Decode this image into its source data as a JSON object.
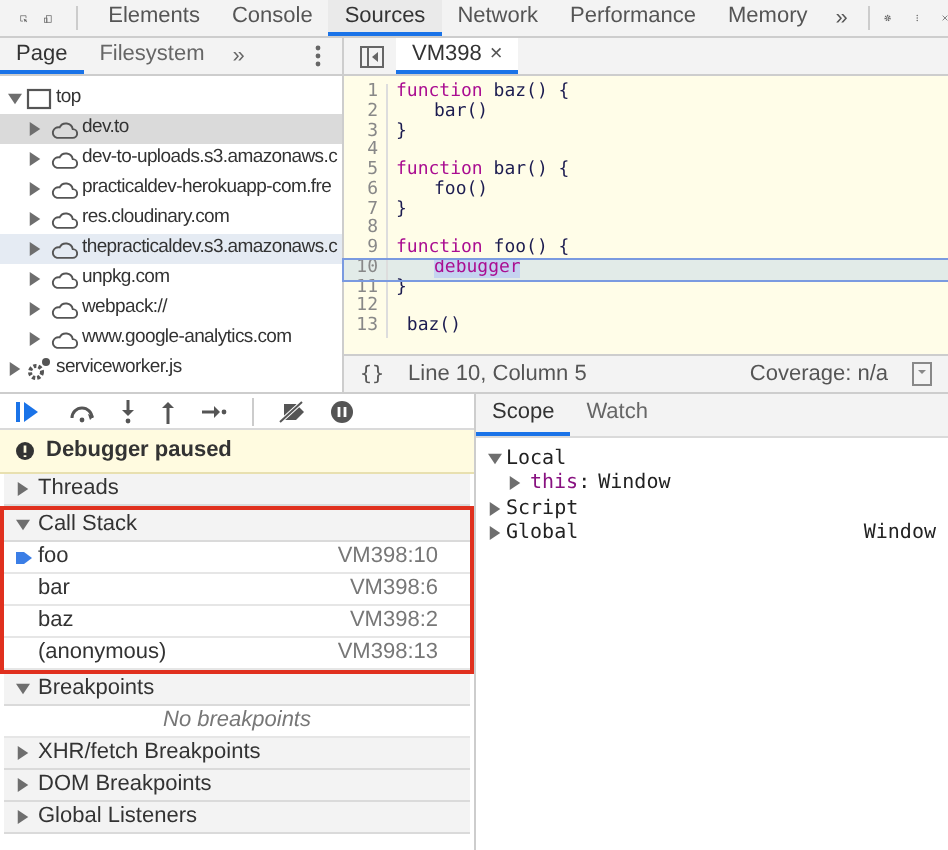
{
  "main_tabs": [
    {
      "label": "Elements",
      "selected": false
    },
    {
      "label": "Console",
      "selected": false
    },
    {
      "label": "Sources",
      "selected": true
    },
    {
      "label": "Network",
      "selected": false
    },
    {
      "label": "Performance",
      "selected": false
    },
    {
      "label": "Memory",
      "selected": false
    }
  ],
  "more_tabs": "»",
  "navigator": {
    "tabs": [
      {
        "label": "Page",
        "selected": true
      },
      {
        "label": "Filesystem",
        "selected": false
      }
    ],
    "more": "»",
    "tree": [
      {
        "label": "top",
        "kind": "frame",
        "expanded": true,
        "selected": false,
        "hovered": false,
        "children": [
          {
            "label": "dev.to",
            "kind": "origin",
            "expanded": false,
            "selected": true,
            "hovered": false
          },
          {
            "label": "dev-to-uploads.s3.amazonaws.c",
            "kind": "origin",
            "expanded": false,
            "selected": false,
            "hovered": false
          },
          {
            "label": "practicaldev-herokuapp-com.fre",
            "kind": "origin",
            "expanded": false,
            "selected": false,
            "hovered": false
          },
          {
            "label": "res.cloudinary.com",
            "kind": "origin",
            "expanded": false,
            "selected": false,
            "hovered": false
          },
          {
            "label": "thepracticaldev.s3.amazonaws.c",
            "kind": "origin",
            "expanded": false,
            "selected": false,
            "hovered": true
          },
          {
            "label": "unpkg.com",
            "kind": "origin",
            "expanded": false,
            "selected": false,
            "hovered": false
          },
          {
            "label": "webpack://",
            "kind": "origin",
            "expanded": false,
            "selected": false,
            "hovered": false
          },
          {
            "label": "www.google-analytics.com",
            "kind": "origin",
            "expanded": false,
            "selected": false,
            "hovered": false
          }
        ]
      },
      {
        "label": "serviceworker.js",
        "kind": "worker",
        "expanded": false,
        "selected": false,
        "hovered": false
      }
    ]
  },
  "editor": {
    "tab": {
      "label": "VM398",
      "close": "×"
    },
    "lines": [
      {
        "number": "1",
        "selected": false,
        "tokens": [
          {
            "text": "function",
            "kind": "keyword"
          },
          {
            "text": " baz() {",
            "kind": "plain"
          }
        ]
      },
      {
        "number": "2",
        "selected": false,
        "indented": true,
        "tokens": [
          {
            "text": "bar()",
            "kind": "plain"
          }
        ]
      },
      {
        "number": "3",
        "selected": false,
        "tokens": [
          {
            "text": "}",
            "kind": "plain"
          }
        ]
      },
      {
        "number": "4",
        "selected": false
      },
      {
        "number": "5",
        "selected": false,
        "tokens": [
          {
            "text": "function",
            "kind": "keyword"
          },
          {
            "text": " bar() {",
            "kind": "plain"
          }
        ]
      },
      {
        "number": "6",
        "selected": false,
        "indented": true,
        "tokens": [
          {
            "text": "foo()",
            "kind": "plain"
          }
        ]
      },
      {
        "number": "7",
        "selected": false,
        "tokens": [
          {
            "text": "}",
            "kind": "plain"
          }
        ]
      },
      {
        "number": "8",
        "selected": false
      },
      {
        "number": "9",
        "selected": false,
        "tokens": [
          {
            "text": "function",
            "kind": "keyword"
          },
          {
            "text": " foo() {",
            "kind": "plain"
          }
        ]
      },
      {
        "number": "10",
        "selected": true,
        "indented": true,
        "tokens": [
          {
            "text": "debugger",
            "kind": "highlight"
          }
        ]
      },
      {
        "number": "11",
        "selected": false,
        "tokens": [
          {
            "text": "}",
            "kind": "plain"
          }
        ]
      },
      {
        "number": "12",
        "selected": false
      },
      {
        "number": "13",
        "selected": false,
        "tokens": [
          {
            "text": " baz()",
            "kind": "plain"
          }
        ]
      }
    ],
    "status": {
      "format": "{}",
      "position": "Line 10, Column 5",
      "coverage": "Coverage: n/a"
    }
  },
  "debugger": {
    "banner": "Debugger paused",
    "sections": [
      {
        "title": "Threads",
        "expanded": false,
        "highlighted": false
      },
      {
        "title": "Call Stack",
        "expanded": true,
        "highlighted": true,
        "frames": [
          {
            "name": "foo",
            "location": "VM398:10",
            "selected": true
          },
          {
            "name": "bar",
            "location": "VM398:6",
            "selected": false
          },
          {
            "name": "baz",
            "location": "VM398:2",
            "selected": false
          },
          {
            "name": "(anonymous)",
            "location": "VM398:13",
            "selected": false
          }
        ]
      },
      {
        "title": "Breakpoints",
        "expanded": true,
        "highlighted": false,
        "empty_message": "No breakpoints"
      },
      {
        "title": "XHR/fetch Breakpoints",
        "expanded": false,
        "highlighted": false
      },
      {
        "title": "DOM Breakpoints",
        "expanded": false,
        "highlighted": false
      },
      {
        "title": "Global Listeners",
        "expanded": false,
        "highlighted": false
      }
    ]
  },
  "sidebar": {
    "tabs": [
      {
        "label": "Scope",
        "selected": true
      },
      {
        "label": "Watch",
        "selected": false
      }
    ],
    "scope": [
      {
        "name": "Local",
        "expanded": true,
        "children": [
          {
            "name": "this",
            "separator": ":",
            "value": "Window",
            "expanded": false
          }
        ]
      },
      {
        "name": "Script",
        "expanded": false
      },
      {
        "name": "Global",
        "expanded": false,
        "value": "Window"
      }
    ]
  }
}
